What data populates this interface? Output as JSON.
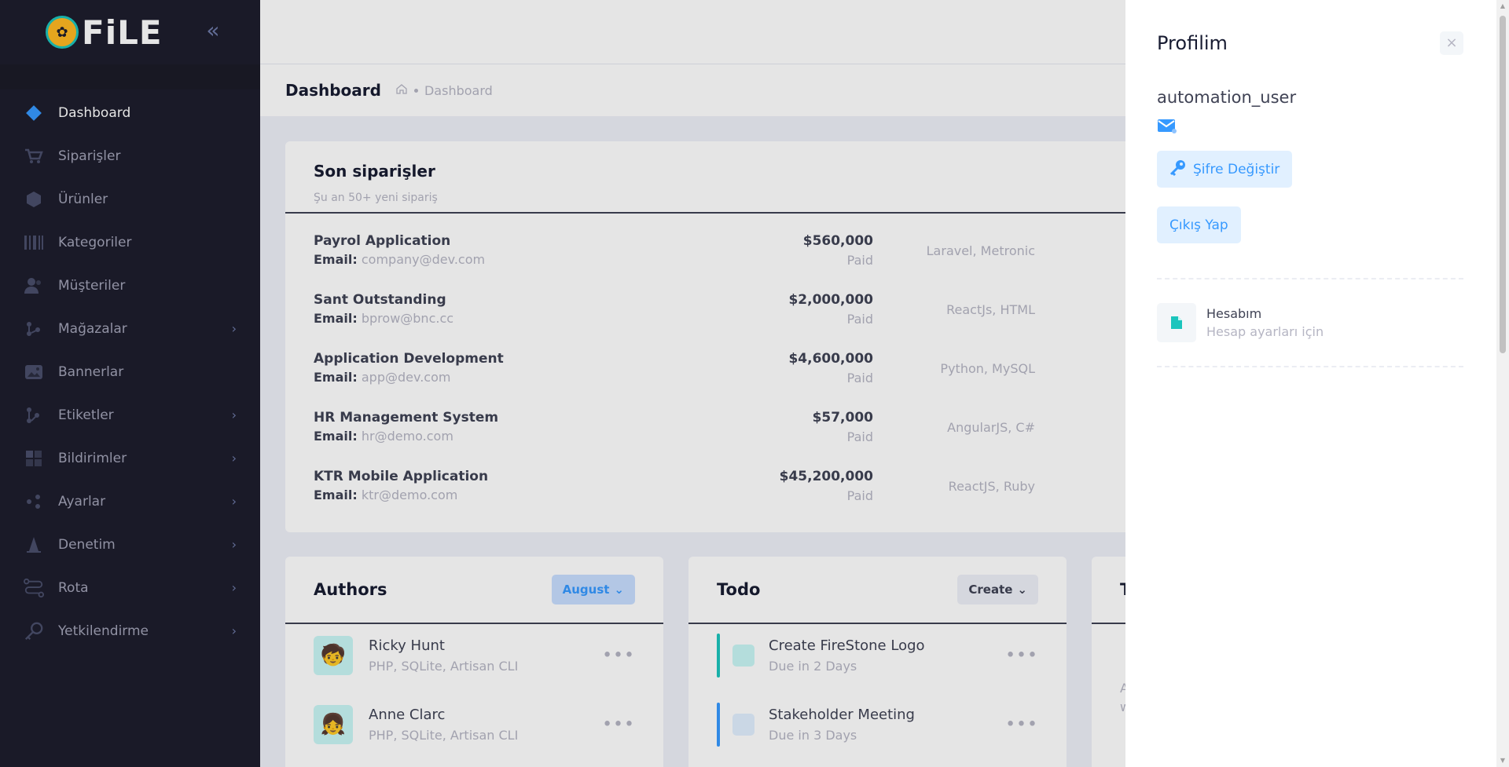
{
  "app": {
    "logo_text": "FiLE"
  },
  "sidebar": {
    "items": [
      {
        "label": "Dashboard",
        "icon": "diamond-icon",
        "active": true,
        "has_arrow": false
      },
      {
        "label": "Siparişler",
        "icon": "cart-icon",
        "has_arrow": false
      },
      {
        "label": "Ürünler",
        "icon": "box-icon",
        "has_arrow": false
      },
      {
        "label": "Kategoriler",
        "icon": "barcode-icon",
        "has_arrow": false
      },
      {
        "label": "Müşteriler",
        "icon": "users-icon",
        "has_arrow": false
      },
      {
        "label": "Mağazalar",
        "icon": "store-icon",
        "has_arrow": true
      },
      {
        "label": "Bannerlar",
        "icon": "image-icon",
        "has_arrow": false
      },
      {
        "label": "Etiketler",
        "icon": "tag-icon",
        "has_arrow": true
      },
      {
        "label": "Bildirimler",
        "icon": "grid-icon",
        "has_arrow": true
      },
      {
        "label": "Ayarlar",
        "icon": "settings-icon",
        "has_arrow": true
      },
      {
        "label": "Denetim",
        "icon": "cone-icon",
        "has_arrow": true
      },
      {
        "label": "Rota",
        "icon": "route-icon",
        "has_arrow": true
      },
      {
        "label": "Yetkilendirme",
        "icon": "key-icon",
        "has_arrow": true
      }
    ]
  },
  "header": {
    "page_title": "Dashboard",
    "breadcrumb": "Dashboard"
  },
  "orders": {
    "title": "Son siparişler",
    "subtitle": "Şu an 50+ yeni sipariş",
    "email_label": "Email:",
    "rows": [
      {
        "name": "Payrol Application",
        "email": "company@dev.com",
        "amount": "$560,000",
        "status": "Paid",
        "tech": "Laravel, Metronic"
      },
      {
        "name": "Sant Outstanding",
        "email": "bprow@bnc.cc",
        "amount": "$2,000,000",
        "status": "Paid",
        "tech": "ReactJs, HTML"
      },
      {
        "name": "Application Development",
        "email": "app@dev.com",
        "amount": "$4,600,000",
        "status": "Paid",
        "tech": "Python, MySQL"
      },
      {
        "name": "HR Management System",
        "email": "hr@demo.com",
        "amount": "$57,000",
        "status": "Paid",
        "tech": "AngularJS, C#"
      },
      {
        "name": "KTR Mobile Application",
        "email": "ktr@demo.com",
        "amount": "$45,200,000",
        "status": "Paid",
        "tech": "ReactJS, Ruby"
      }
    ]
  },
  "authors": {
    "title": "Authors",
    "filter_label": "August",
    "rows": [
      {
        "name": "Ricky Hunt",
        "sub": "PHP, SQLite, Artisan CLI"
      },
      {
        "name": "Anne Clarc",
        "sub": "PHP, SQLite, Artisan CLI"
      }
    ]
  },
  "todo": {
    "title": "Todo",
    "create_label": "Create",
    "rows": [
      {
        "name": "Create FireStone Logo",
        "sub": "Due in 2 Days",
        "color": "#1bc5bd",
        "check_bg": "#c9f7f5"
      },
      {
        "name": "Stakeholder Meeting",
        "sub": "Due in 3 Days",
        "color": "#3699ff",
        "check_bg": "#e1f0ff"
      }
    ]
  },
  "third_card": {
    "title_fragment": "T",
    "text_fragment_1": "A",
    "text_fragment_2": "w"
  },
  "profile_panel": {
    "title": "Profilim",
    "close_symbol": "×",
    "username": "automation_user",
    "change_password_label": "Şifre Değiştir",
    "logout_label": "Çıkış Yap",
    "account": {
      "title": "Hesabım",
      "subtitle": "Hesap ayarları için"
    }
  },
  "colors": {
    "sidebar_bg": "#1e1e2d",
    "primary": "#3699ff",
    "success": "#1bc5bd"
  }
}
